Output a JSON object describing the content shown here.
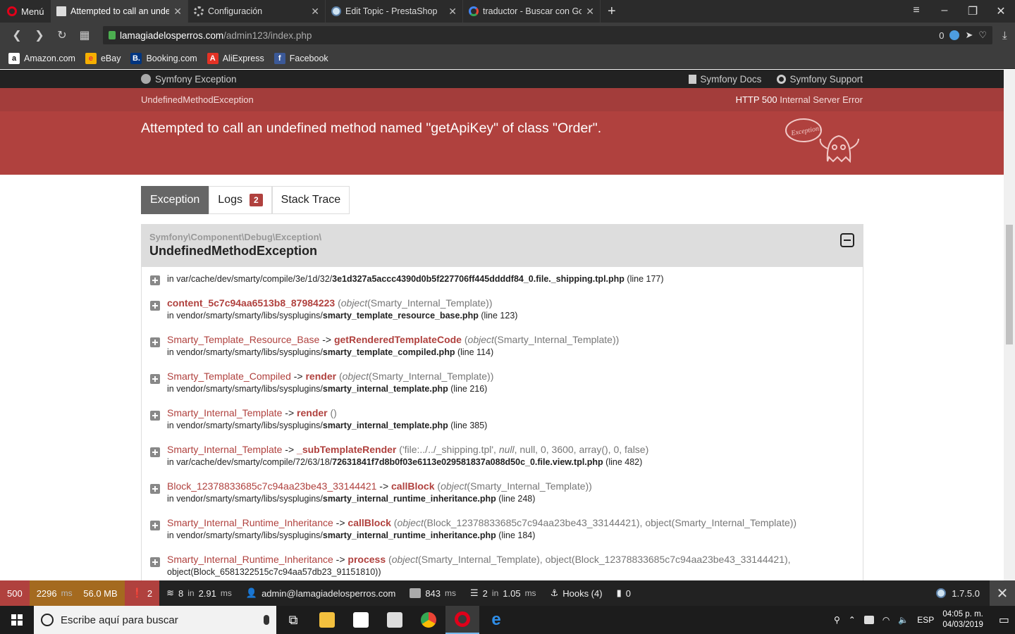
{
  "browser": {
    "menu_label": "Menú",
    "tabs": [
      {
        "title": "Attempted to call an unde",
        "active": true
      },
      {
        "title": "Configuración",
        "active": false
      },
      {
        "title": "Edit Topic - PrestaShop",
        "active": false
      },
      {
        "title": "traductor - Buscar con Goo",
        "active": false
      }
    ],
    "url_host": "lamagiadelosperros.com",
    "url_path": "/admin123/index.php",
    "adblock_count": "0",
    "bookmarks": [
      {
        "label": "Amazon.com",
        "glyph": "a"
      },
      {
        "label": "eBay",
        "glyph": "e"
      },
      {
        "label": "Booking.com",
        "glyph": "B."
      },
      {
        "label": "AliExpress",
        "glyph": "A"
      },
      {
        "label": "Facebook",
        "glyph": "f"
      }
    ]
  },
  "symfony": {
    "brand": "Symfony Exception",
    "docs_link": "Symfony Docs",
    "support_link": "Symfony Support",
    "exception_short": "UndefinedMethodException",
    "http_code": "HTTP 500",
    "http_text": "Internal Server Error",
    "message": "Attempted to call an undefined method named \"getApiKey\" of class \"Order\".",
    "ghost_label": "Exception!"
  },
  "page_tabs": {
    "exception": "Exception",
    "logs": "Logs",
    "logs_count": "2",
    "stack_trace": "Stack Trace"
  },
  "exception": {
    "namespace": "Symfony\\Component\\Debug\\Exception\\",
    "class": "UndefinedMethodException",
    "first_file_prefix": "in var/cache/dev/smarty/compile/3e/1d/32/",
    "first_file_name": "3e1d327a5accc4390d0b5f227706ff445ddddf84_0.file._shipping.tpl.php",
    "first_file_line": "(line 177)",
    "trace": [
      {
        "cls": "",
        "arrow": "",
        "fn": "content_5c7c94aa6513b8_87984223",
        "args_pre": "(",
        "args": "object",
        "args_rest": "(Smarty_Internal_Template))",
        "file_prefix": "in vendor/smarty/smarty/libs/sysplugins/",
        "file_name": "smarty_template_resource_base.php",
        "line": "(line 123)"
      },
      {
        "cls": "Smarty_Template_Resource_Base",
        "arrow": " -> ",
        "fn": "getRenderedTemplateCode",
        "args_pre": "(",
        "args": "object",
        "args_rest": "(Smarty_Internal_Template))",
        "file_prefix": "in vendor/smarty/smarty/libs/sysplugins/",
        "file_name": "smarty_template_compiled.php",
        "line": "(line 114)"
      },
      {
        "cls": "Smarty_Template_Compiled",
        "arrow": " -> ",
        "fn": "render",
        "args_pre": "(",
        "args": "object",
        "args_rest": "(Smarty_Internal_Template))",
        "file_prefix": "in vendor/smarty/smarty/libs/sysplugins/",
        "file_name": "smarty_internal_template.php",
        "line": "(line 216)"
      },
      {
        "cls": "Smarty_Internal_Template",
        "arrow": " -> ",
        "fn": "render",
        "args_pre": "()",
        "args": "",
        "args_rest": "",
        "file_prefix": "in vendor/smarty/smarty/libs/sysplugins/",
        "file_name": "smarty_internal_template.php",
        "line": "(line 385)"
      },
      {
        "cls": "Smarty_Internal_Template",
        "arrow": " -> ",
        "fn": "_subTemplateRender",
        "args_pre": "('file:../../_shipping.tpl', ",
        "args": "null",
        "args_rest": ", null, 0, 3600, array(), 0, false)",
        "file_prefix": "in var/cache/dev/smarty/compile/72/63/18/",
        "file_name": "72631841f7d8b0f03e6113e029581837a088d50c_0.file.view.tpl.php",
        "line": "(line 482)"
      },
      {
        "cls": "Block_12378833685c7c94aa23be43_33144421",
        "arrow": " -> ",
        "fn": "callBlock",
        "args_pre": "(",
        "args": "object",
        "args_rest": "(Smarty_Internal_Template))",
        "file_prefix": "in vendor/smarty/smarty/libs/sysplugins/",
        "file_name": "smarty_internal_runtime_inheritance.php",
        "line": "(line 248)"
      },
      {
        "cls": "Smarty_Internal_Runtime_Inheritance",
        "arrow": " -> ",
        "fn": "callBlock",
        "args_pre": "(",
        "args": "object",
        "args_rest": "(Block_12378833685c7c94aa23be43_33144421), object(Smarty_Internal_Template))",
        "file_prefix": "in vendor/smarty/smarty/libs/sysplugins/",
        "file_name": "smarty_internal_runtime_inheritance.php",
        "line": "(line 184)"
      },
      {
        "cls": "Smarty_Internal_Runtime_Inheritance",
        "arrow": " -> ",
        "fn": "process",
        "args_pre": "(",
        "args": "object",
        "args_rest": "(Smarty_Internal_Template), object(Block_12378833685c7c94aa23be43_33144421),",
        "file_prefix": "object(Block_6581322515c7c94aa57db23_91151810))",
        "file_name": "",
        "line": ""
      }
    ]
  },
  "toolbar": {
    "status": "500",
    "time": "2296",
    "time_unit": "ms",
    "memory": "56.0 MB",
    "errors": "2",
    "cache": "8",
    "cache_in": "in",
    "cache_time": "2.91",
    "cache_unit": "ms",
    "user": "admin@lamagiadelosperros.com",
    "render": "843",
    "render_unit": "ms",
    "db": "2",
    "db_in": "in",
    "db_time": "1.05",
    "db_unit": "ms",
    "hooks": "Hooks (4)",
    "modules": "0",
    "ps_version": "1.7.5.0"
  },
  "taskbar": {
    "search_placeholder": "Escribe aquí para buscar",
    "lang": "ESP",
    "time": "04:05 p. m.",
    "date": "04/03/2019"
  }
}
